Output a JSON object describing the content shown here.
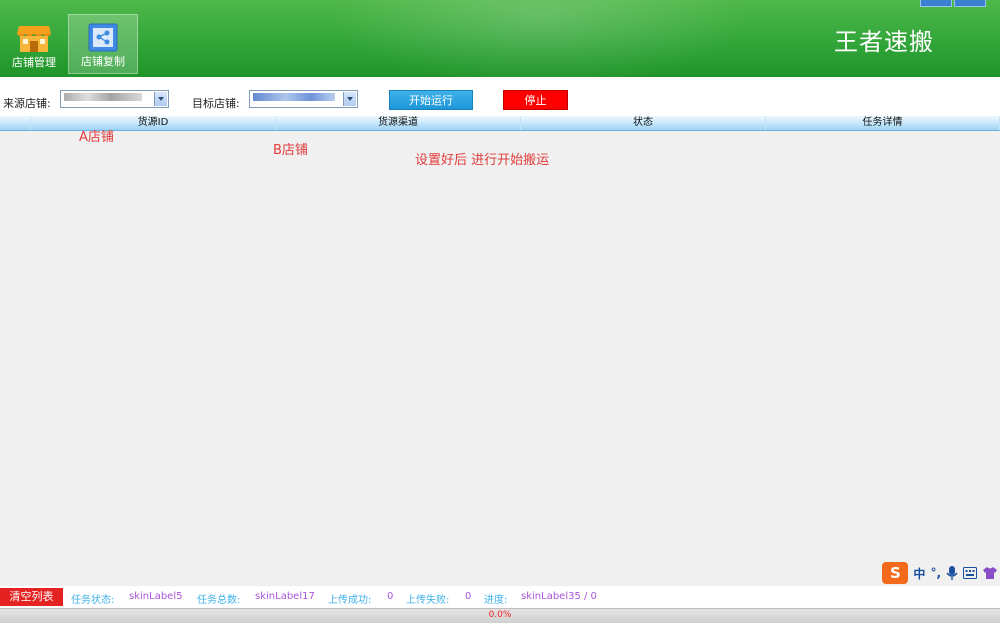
{
  "header": {
    "app_title": "王者速搬",
    "nav": [
      {
        "label": "店铺管理",
        "icon": "shop-icon"
      },
      {
        "label": "店铺复制",
        "icon": "copy-shop-icon"
      }
    ]
  },
  "toolbar": {
    "source_label": "来源店铺:",
    "target_label": "目标店铺:",
    "start_label": "开始运行",
    "stop_label": "停止"
  },
  "grid": {
    "columns": [
      "货源ID",
      "货源渠道",
      "状态",
      "任务详情"
    ]
  },
  "annotations": {
    "a": "A店铺",
    "b": "B店铺",
    "c": "设置好后 进行开始搬运"
  },
  "tray": {
    "logo": "S",
    "lang": "中",
    "punct": "°,"
  },
  "status": {
    "clear_label": "清空列表",
    "task_state_key": "任务状态:",
    "task_state_val": "skinLabel5",
    "task_total_key": "任务总数:",
    "task_total_val": "skinLabel17",
    "upload_ok_key": "上传成功:",
    "upload_ok_val": "0",
    "upload_fail_key": "上传失败:",
    "upload_fail_val": "0",
    "progress_key": "进度:",
    "progress_val": "skinLabel35 / 0"
  },
  "progress": {
    "text": "0.0%",
    "fraction": 0.0
  },
  "colors": {
    "header_green": "#33a63a",
    "start_blue": "#1e96d8",
    "stop_red": "#ff0000",
    "annotation_red": "#e23b3b"
  }
}
